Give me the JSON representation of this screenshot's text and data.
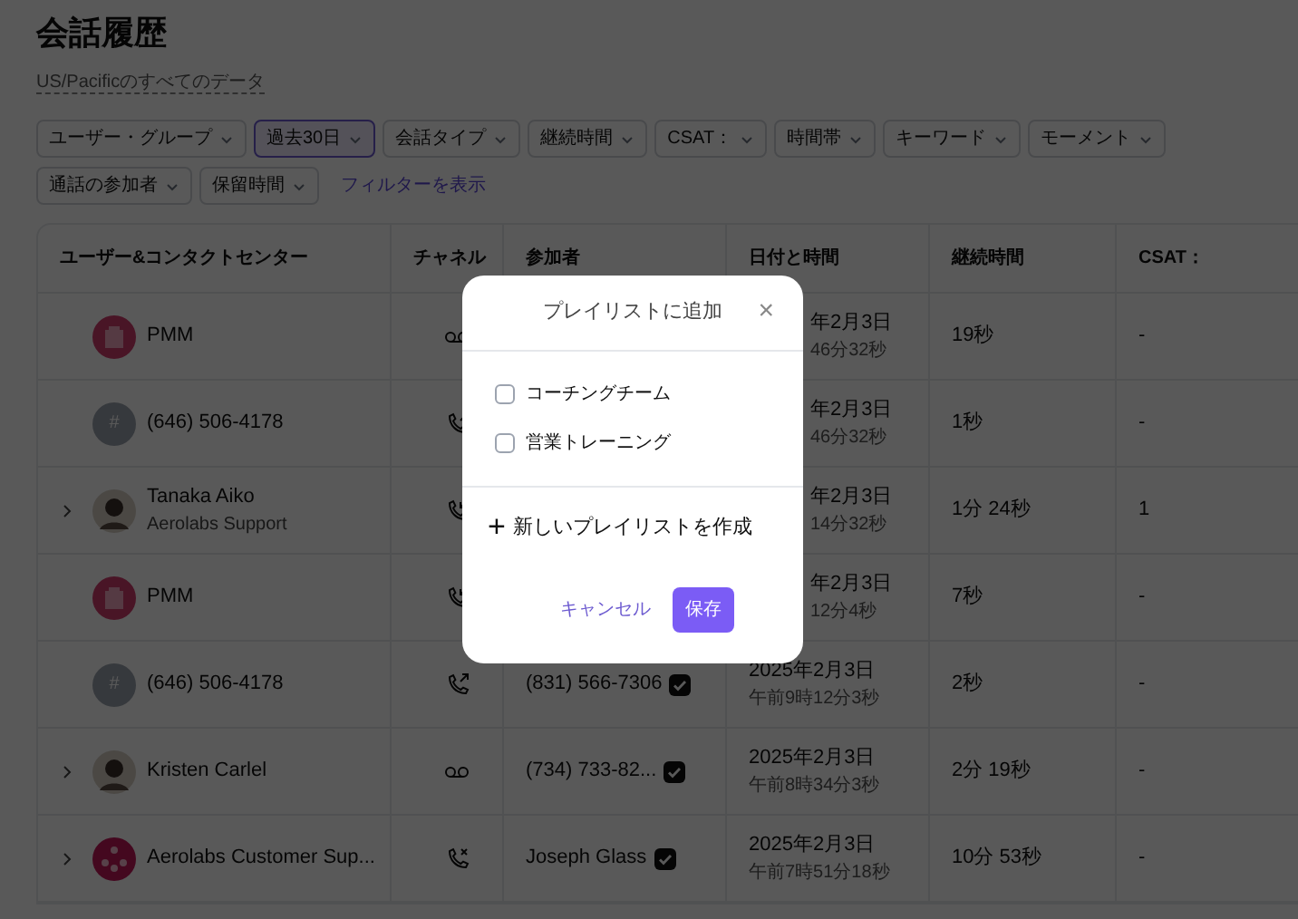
{
  "page": {
    "title": "会話履歴",
    "subtitle": "US/Pacificのすべてのデータ"
  },
  "filters": [
    {
      "label": "ユーザー・グループ",
      "selected": false
    },
    {
      "label": "過去30日",
      "selected": true
    },
    {
      "label": "会話タイプ",
      "selected": false
    },
    {
      "label": "継続時間",
      "selected": false
    },
    {
      "label": "CSAT：",
      "selected": false
    },
    {
      "label": "時間帯",
      "selected": false
    },
    {
      "label": "キーワード",
      "selected": false
    },
    {
      "label": "モーメント",
      "selected": false
    },
    {
      "label": "通話の参加者",
      "selected": false
    },
    {
      "label": "保留時間",
      "selected": false
    }
  ],
  "show_filters_link": "フィルターを表示",
  "table": {
    "columns": [
      "ユーザー&コンタクトセンター",
      "チャネル",
      "参加者",
      "日付と時間",
      "継続時間",
      "CSAT："
    ],
    "rows": [
      {
        "expandable": false,
        "avatar": {
          "kind": "building"
        },
        "name": "PMM",
        "channel": {
          "kind": "voicemail"
        },
        "date": "年2月3日",
        "time": "46分32秒",
        "duration": "19秒",
        "csat": "-"
      },
      {
        "expandable": false,
        "avatar": {
          "kind": "number",
          "text": "#"
        },
        "name": "(646) 506-4178",
        "channel": {
          "kind": "outgoing"
        },
        "date": "年2月3日",
        "time": "46分32秒",
        "duration": "1秒",
        "csat": "-"
      },
      {
        "expandable": true,
        "avatar": {
          "kind": "person"
        },
        "name": "Tanaka Aiko",
        "team": "Aerolabs Support",
        "channel": {
          "kind": "incoming"
        },
        "date": "年2月3日",
        "time": "14分32秒",
        "duration": "1分 24秒",
        "csat": "1"
      },
      {
        "expandable": false,
        "avatar": {
          "kind": "building"
        },
        "name": "PMM",
        "channel": {
          "kind": "incoming"
        },
        "date": "年2月3日",
        "time": "12分4秒",
        "duration": "7秒",
        "csat": "-"
      },
      {
        "expandable": false,
        "avatar": {
          "kind": "number",
          "text": "#"
        },
        "name": "(646) 506-4178",
        "channel": {
          "kind": "outgoing"
        },
        "participant": "(831) 566-7306",
        "date": "2025年2月3日",
        "time": "午前9時12分3秒",
        "duration": "2秒",
        "csat": "-"
      },
      {
        "expandable": true,
        "avatar": {
          "kind": "person"
        },
        "name": "Kristen Carlel",
        "channel": {
          "kind": "voicemail"
        },
        "participant": "(734) 733-82...",
        "date": "2025年2月3日",
        "time": "午前8時34分3秒",
        "duration": "2分 19秒",
        "csat": "-"
      },
      {
        "expandable": true,
        "avatar": {
          "kind": "team"
        },
        "name": "Aerolabs Customer Sup...",
        "channel": {
          "kind": "missed"
        },
        "participant": "Joseph Glass",
        "date": "2025年2月3日",
        "time": "午前7時51分18秒",
        "duration": "10分 53秒",
        "csat": "-"
      }
    ]
  },
  "dialog": {
    "title": "プレイリストに追加",
    "close": "×",
    "playlists": [
      {
        "label": "コーチングチーム",
        "checked": false
      },
      {
        "label": "営業トレーニング",
        "checked": false
      }
    ],
    "create": {
      "icon": "+",
      "label": "新しいプレイリストを作成"
    },
    "cancel": "キャンセル",
    "save": "保存"
  }
}
